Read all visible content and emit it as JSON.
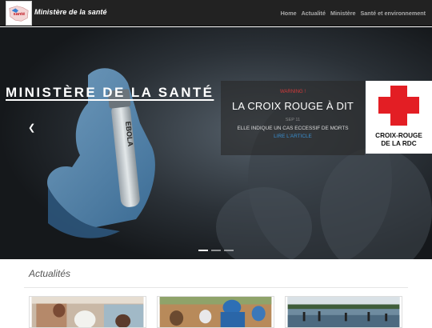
{
  "navbar": {
    "logo_text": "santé",
    "brand": "Ministère de la santé",
    "links": [
      "Home",
      "Actualité",
      "Ministère",
      "Santé et environnement"
    ]
  },
  "hero": {
    "title": "MINISTÈRE DE LA SANTÉ",
    "tube_label": "EBOLA",
    "prev_icon": "chevron-left",
    "next_icon": "chevron-right",
    "card": {
      "warning": "WARNING !",
      "headline": "LA CROIX ROUGE À DIT",
      "date": "SEP 11",
      "description": "ELLE INDIQUE UN CAS ECCESSIF DE MORTS",
      "link": "LIRE L'ARTICLE"
    },
    "redcross": {
      "line1": "CROIX-ROUGE",
      "line2": "DE LA RDC",
      "color": "#e31e24"
    },
    "slides": 3,
    "active_slide": 1
  },
  "news": {
    "title": "Actualités"
  },
  "colors": {
    "navbar_bg": "#222222",
    "warning": "#d43a3a",
    "link": "#3a8fd1"
  }
}
